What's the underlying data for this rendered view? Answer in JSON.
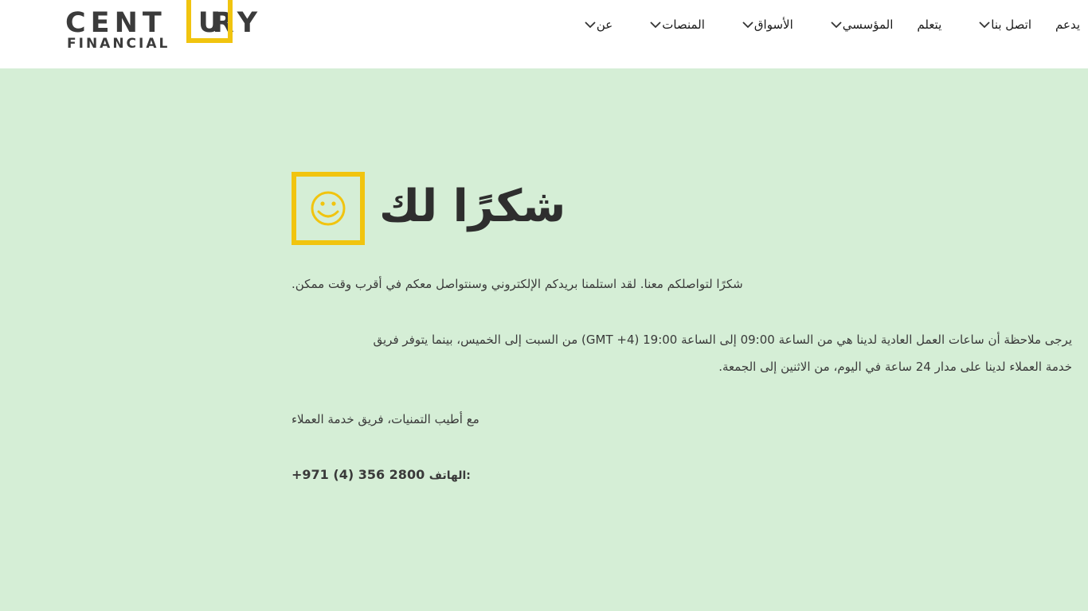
{
  "brand": {
    "logo_top_left": "CENT",
    "logo_box_letter": "U",
    "logo_top_right": "RY",
    "logo_bottom": "FINANCIAL",
    "accent_color": "#f1c40f"
  },
  "nav": {
    "items": [
      {
        "label": "يدعم",
        "chevron": false
      },
      {
        "label": "اتصل بنا",
        "chevron": true
      },
      {
        "label": "يتعلم",
        "chevron": false
      },
      {
        "label": "المؤسسي",
        "chevron": true
      },
      {
        "label": "الأسواق",
        "chevron": true
      },
      {
        "label": "المنصات",
        "chevron": true
      },
      {
        "label": "عن",
        "chevron": true
      }
    ]
  },
  "main": {
    "background_color": "#d5eed6",
    "title": "شكرًا لك",
    "icon": "smiley-icon",
    "paragraph1": "شكرًا لتواصلكم معنا. لقد استلمنا بريدكم الإلكتروني وسنتواصل معكم في أقرب وقت ممكن.",
    "paragraph2_line1": "يرجى ملاحظة أن ساعات العمل العادية لدينا هي من الساعة 09:00 إلى الساعة 19:00 (GMT +4) من السبت إلى الخميس، بينما يتوفر فريق",
    "paragraph2_line2": "خدمة العملاء لدينا على مدار 24 ساعة في اليوم، من الاثنين إلى الجمعة.",
    "signoff": "مع أطيب التمنيات، فريق خدمة العملاء",
    "phone_label": "الهاتف:",
    "phone_number": "+971 (4) 356 2800"
  }
}
